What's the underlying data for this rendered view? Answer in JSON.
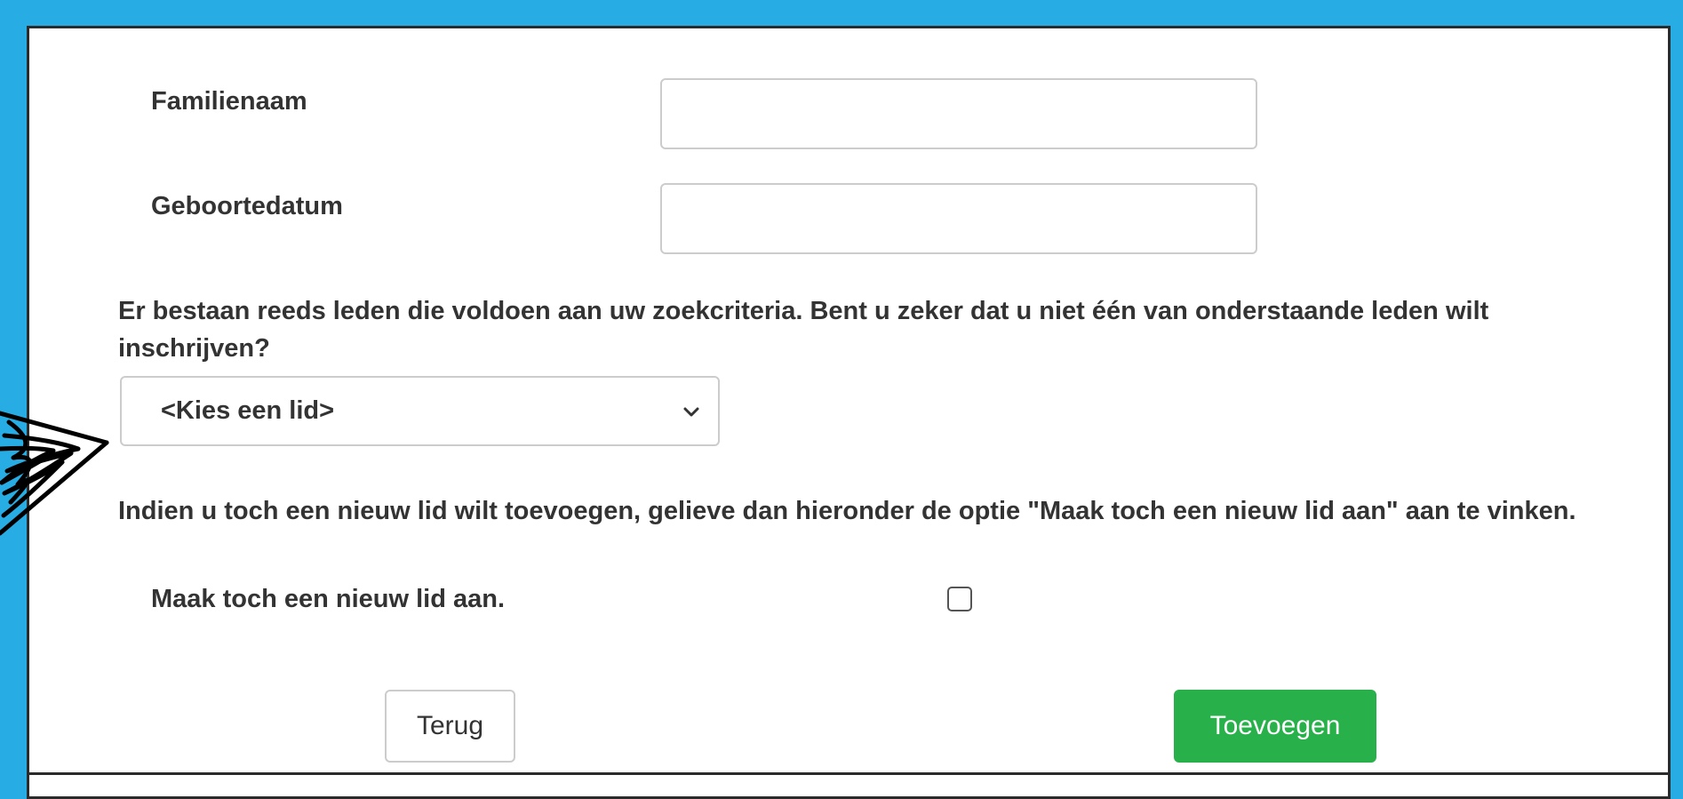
{
  "form": {
    "familienaam_label": "Familienaam",
    "familienaam_value": "",
    "geboortedatum_label": "Geboortedatum",
    "geboortedatum_value": "",
    "existing_members_notice": "Er bestaan reeds leden die voldoen aan uw zoekcriteria. Bent u zeker dat u niet één van onderstaande leden wilt inschrijven?",
    "member_select_value": "<Kies een lid>",
    "new_member_notice": "Indien u toch een nieuw lid wilt toevoegen, gelieve dan hieronder de optie \"Maak toch een nieuw lid aan\" aan te vinken.",
    "new_member_checkbox_label": "Maak toch een nieuw lid aan.",
    "new_member_checked": false,
    "back_button": "Terug",
    "add_button": "Toevoegen"
  },
  "colors": {
    "background": "#27ace3",
    "add_button": "#28b14a",
    "text": "#333333"
  },
  "icons": {
    "select_arrow": "chevron-down-icon"
  }
}
